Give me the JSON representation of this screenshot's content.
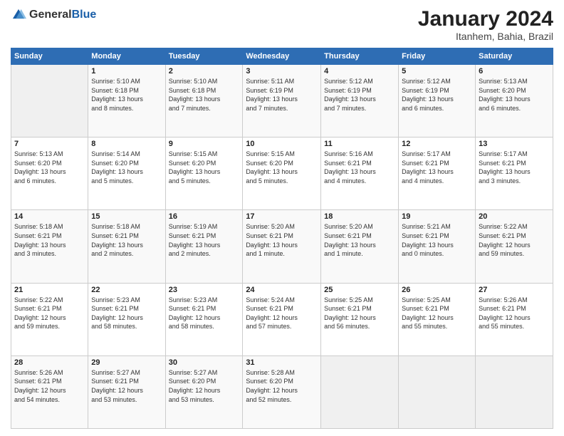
{
  "header": {
    "logo_general": "General",
    "logo_blue": "Blue",
    "month_year": "January 2024",
    "location": "Itanhem, Bahia, Brazil"
  },
  "days_of_week": [
    "Sunday",
    "Monday",
    "Tuesday",
    "Wednesday",
    "Thursday",
    "Friday",
    "Saturday"
  ],
  "weeks": [
    [
      {
        "day": "",
        "content": ""
      },
      {
        "day": "1",
        "content": "Sunrise: 5:10 AM\nSunset: 6:18 PM\nDaylight: 13 hours\nand 8 minutes."
      },
      {
        "day": "2",
        "content": "Sunrise: 5:10 AM\nSunset: 6:18 PM\nDaylight: 13 hours\nand 7 minutes."
      },
      {
        "day": "3",
        "content": "Sunrise: 5:11 AM\nSunset: 6:19 PM\nDaylight: 13 hours\nand 7 minutes."
      },
      {
        "day": "4",
        "content": "Sunrise: 5:12 AM\nSunset: 6:19 PM\nDaylight: 13 hours\nand 7 minutes."
      },
      {
        "day": "5",
        "content": "Sunrise: 5:12 AM\nSunset: 6:19 PM\nDaylight: 13 hours\nand 6 minutes."
      },
      {
        "day": "6",
        "content": "Sunrise: 5:13 AM\nSunset: 6:20 PM\nDaylight: 13 hours\nand 6 minutes."
      }
    ],
    [
      {
        "day": "7",
        "content": "Sunrise: 5:13 AM\nSunset: 6:20 PM\nDaylight: 13 hours\nand 6 minutes."
      },
      {
        "day": "8",
        "content": "Sunrise: 5:14 AM\nSunset: 6:20 PM\nDaylight: 13 hours\nand 5 minutes."
      },
      {
        "day": "9",
        "content": "Sunrise: 5:15 AM\nSunset: 6:20 PM\nDaylight: 13 hours\nand 5 minutes."
      },
      {
        "day": "10",
        "content": "Sunrise: 5:15 AM\nSunset: 6:20 PM\nDaylight: 13 hours\nand 5 minutes."
      },
      {
        "day": "11",
        "content": "Sunrise: 5:16 AM\nSunset: 6:21 PM\nDaylight: 13 hours\nand 4 minutes."
      },
      {
        "day": "12",
        "content": "Sunrise: 5:17 AM\nSunset: 6:21 PM\nDaylight: 13 hours\nand 4 minutes."
      },
      {
        "day": "13",
        "content": "Sunrise: 5:17 AM\nSunset: 6:21 PM\nDaylight: 13 hours\nand 3 minutes."
      }
    ],
    [
      {
        "day": "14",
        "content": "Sunrise: 5:18 AM\nSunset: 6:21 PM\nDaylight: 13 hours\nand 3 minutes."
      },
      {
        "day": "15",
        "content": "Sunrise: 5:18 AM\nSunset: 6:21 PM\nDaylight: 13 hours\nand 2 minutes."
      },
      {
        "day": "16",
        "content": "Sunrise: 5:19 AM\nSunset: 6:21 PM\nDaylight: 13 hours\nand 2 minutes."
      },
      {
        "day": "17",
        "content": "Sunrise: 5:20 AM\nSunset: 6:21 PM\nDaylight: 13 hours\nand 1 minute."
      },
      {
        "day": "18",
        "content": "Sunrise: 5:20 AM\nSunset: 6:21 PM\nDaylight: 13 hours\nand 1 minute."
      },
      {
        "day": "19",
        "content": "Sunrise: 5:21 AM\nSunset: 6:21 PM\nDaylight: 13 hours\nand 0 minutes."
      },
      {
        "day": "20",
        "content": "Sunrise: 5:22 AM\nSunset: 6:21 PM\nDaylight: 12 hours\nand 59 minutes."
      }
    ],
    [
      {
        "day": "21",
        "content": "Sunrise: 5:22 AM\nSunset: 6:21 PM\nDaylight: 12 hours\nand 59 minutes."
      },
      {
        "day": "22",
        "content": "Sunrise: 5:23 AM\nSunset: 6:21 PM\nDaylight: 12 hours\nand 58 minutes."
      },
      {
        "day": "23",
        "content": "Sunrise: 5:23 AM\nSunset: 6:21 PM\nDaylight: 12 hours\nand 58 minutes."
      },
      {
        "day": "24",
        "content": "Sunrise: 5:24 AM\nSunset: 6:21 PM\nDaylight: 12 hours\nand 57 minutes."
      },
      {
        "day": "25",
        "content": "Sunrise: 5:25 AM\nSunset: 6:21 PM\nDaylight: 12 hours\nand 56 minutes."
      },
      {
        "day": "26",
        "content": "Sunrise: 5:25 AM\nSunset: 6:21 PM\nDaylight: 12 hours\nand 55 minutes."
      },
      {
        "day": "27",
        "content": "Sunrise: 5:26 AM\nSunset: 6:21 PM\nDaylight: 12 hours\nand 55 minutes."
      }
    ],
    [
      {
        "day": "28",
        "content": "Sunrise: 5:26 AM\nSunset: 6:21 PM\nDaylight: 12 hours\nand 54 minutes."
      },
      {
        "day": "29",
        "content": "Sunrise: 5:27 AM\nSunset: 6:21 PM\nDaylight: 12 hours\nand 53 minutes."
      },
      {
        "day": "30",
        "content": "Sunrise: 5:27 AM\nSunset: 6:20 PM\nDaylight: 12 hours\nand 53 minutes."
      },
      {
        "day": "31",
        "content": "Sunrise: 5:28 AM\nSunset: 6:20 PM\nDaylight: 12 hours\nand 52 minutes."
      },
      {
        "day": "",
        "content": ""
      },
      {
        "day": "",
        "content": ""
      },
      {
        "day": "",
        "content": ""
      }
    ]
  ]
}
